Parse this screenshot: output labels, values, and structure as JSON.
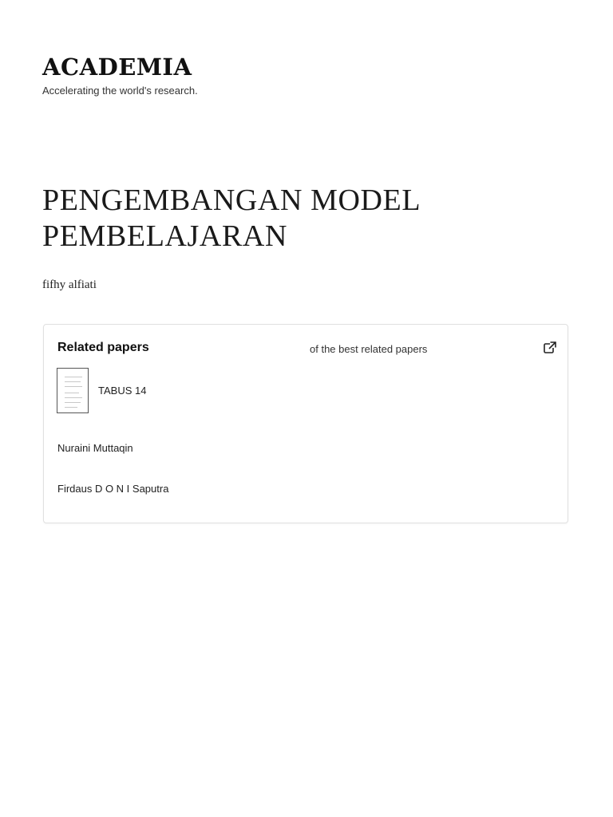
{
  "brand": {
    "logo": "ACADEMIA",
    "tagline": "Accelerating the world's research."
  },
  "paper": {
    "title": "PENGEMBANGAN MODEL PEMBELAJARAN",
    "author": "fifhy alfiati"
  },
  "related": {
    "heading": "Related papers",
    "subheading": "of the best related papers",
    "link_icon": "external-link-icon",
    "items": [
      {
        "title": "TABUS 14",
        "thumbnail_icon": "document-thumbnail-icon"
      }
    ],
    "authors": [
      "Nuraini Muttaqin",
      "Firdaus D O N I Saputra"
    ]
  }
}
